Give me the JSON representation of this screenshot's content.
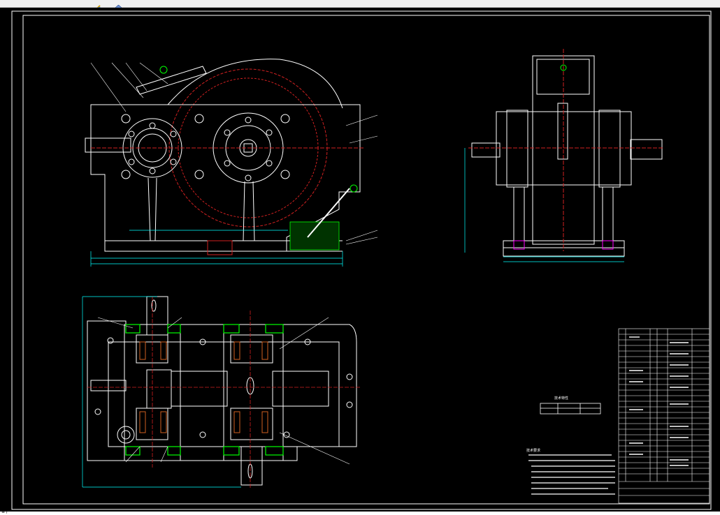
{
  "app": {
    "toolbar_icons": [
      "draw-tool-icon",
      "layer-icon"
    ],
    "status_text": "≡ /"
  },
  "drawing": {
    "tech_characteristics_title": "技术特性",
    "tech_requirements_title": "技术要求",
    "colors": {
      "background": "#000000",
      "outline": "#ffffff",
      "centerline": "#ff2020",
      "dimension": "#00ffff",
      "seal": "#00ff00",
      "highlight": "#ff00ff"
    }
  }
}
